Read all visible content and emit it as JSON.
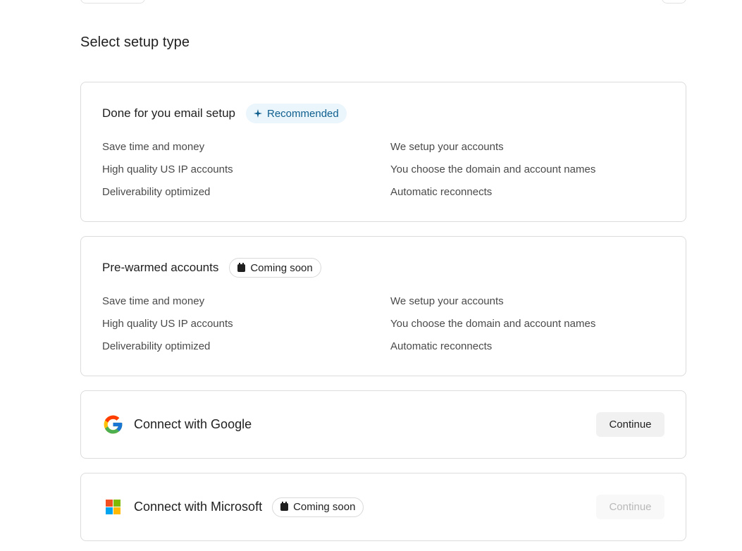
{
  "section_title": "Select setup type",
  "done_for_you": {
    "title": "Done for you email setup",
    "badge_label": "Recommended",
    "features_left": [
      "Save time and money",
      "High quality US IP accounts",
      "Deliverability optimized"
    ],
    "features_right": [
      "We setup your accounts",
      "You choose the domain and account names",
      "Automatic reconnects"
    ]
  },
  "pre_warmed": {
    "title": "Pre-warmed accounts",
    "badge_label": "Coming soon",
    "features_left": [
      "Save time and money",
      "High quality US IP accounts",
      "Deliverability optimized"
    ],
    "features_right": [
      "We setup your accounts",
      "You choose the domain and account names",
      "Automatic reconnects"
    ]
  },
  "google": {
    "title": "Connect with Google",
    "button_label": "Continue",
    "icon": "google-logo-icon"
  },
  "microsoft": {
    "title": "Connect with Microsoft",
    "badge_label": "Coming soon",
    "button_label": "Continue",
    "icon": "microsoft-logo-icon"
  },
  "colors": {
    "recommended_bg": "#eaf5fc",
    "recommended_text": "#0f5f8f",
    "card_border": "#dcdcdc",
    "ms_red": "#f25022",
    "ms_green": "#7fba00",
    "ms_blue": "#00a4ef",
    "ms_yellow": "#ffb900"
  }
}
